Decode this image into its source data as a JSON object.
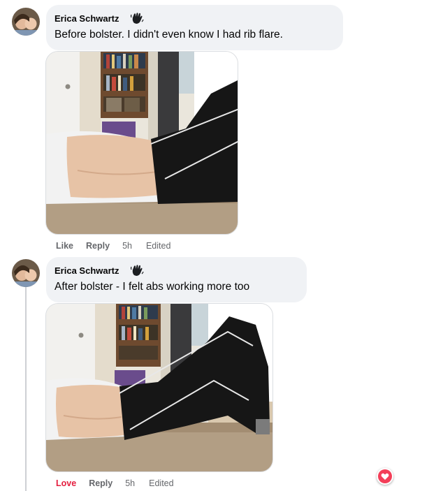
{
  "comments": [
    {
      "author": "Erica Schwartz",
      "text": "Before bolster. I didn't even know I had rib flare.",
      "actions": {
        "like": "Like",
        "reply": "Reply",
        "time": "5h",
        "edited": "Edited"
      }
    },
    {
      "author": "Erica Schwartz",
      "text": "After bolster - I felt abs working more too",
      "actions": {
        "like": "Love",
        "reply": "Reply",
        "time": "5h",
        "edited": "Edited"
      }
    }
  ],
  "colors": {
    "love": "#e41e3f",
    "bubble": "#f0f2f5",
    "meta": "#65676b"
  },
  "icons": [
    "waving-hand-icon",
    "heart-reaction-icon"
  ]
}
